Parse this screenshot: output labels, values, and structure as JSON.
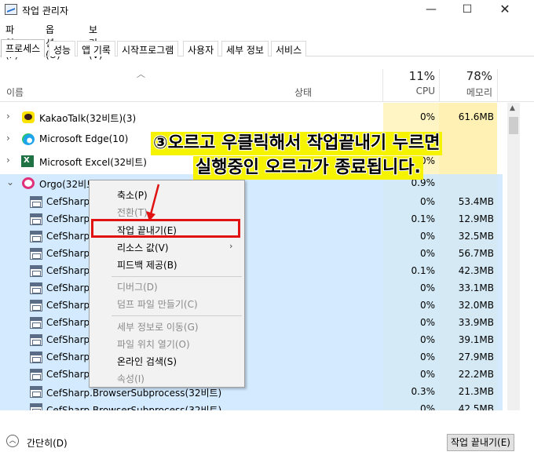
{
  "window": {
    "title": "작업 관리자",
    "minimize": "—",
    "maximize": "☐",
    "close": "✕"
  },
  "menu": [
    "파일(F)",
    "옵션(O)",
    "보기(V)"
  ],
  "tabs": [
    "프로세스",
    "성능",
    "앱 기록",
    "시작프로그램",
    "사용자",
    "세부 정보",
    "서비스"
  ],
  "columns": {
    "name": "이름",
    "status": "상태",
    "cpu_pct": "11%",
    "cpu_label": "CPU",
    "mem_pct": "78%",
    "mem_label": "메모리"
  },
  "processes": [
    {
      "name": "KakaoTalk(32비트)(3)",
      "cpu": "0%",
      "mem": "61.6MB",
      "icon": "kakaotalk-icon"
    },
    {
      "name": "Microsoft Edge(10)",
      "cpu": "0%",
      "mem": "",
      "icon": "edge-icon"
    },
    {
      "name": "Microsoft Excel(32비트)",
      "cpu": "0%",
      "mem": "",
      "icon": "excel-icon"
    },
    {
      "name": "Orgo(32비트)(27)",
      "cpu": "0.9%",
      "mem": "",
      "icon": "orgo-icon"
    }
  ],
  "subprocesses": [
    {
      "name": "CefSharp.B",
      "cpu": "0%",
      "mem": "53.4MB"
    },
    {
      "name": "CefSharp.B",
      "cpu": "0.1%",
      "mem": "12.9MB"
    },
    {
      "name": "CefSharp.B",
      "cpu": "0%",
      "mem": "32.5MB"
    },
    {
      "name": "CefSharp.B",
      "cpu": "0%",
      "mem": "56.7MB"
    },
    {
      "name": "CefSharp.B",
      "cpu": "0.1%",
      "mem": "42.3MB"
    },
    {
      "name": "CefSharp.B",
      "cpu": "0%",
      "mem": "33.1MB"
    },
    {
      "name": "CefSharp.B",
      "cpu": "0%",
      "mem": "32.0MB"
    },
    {
      "name": "CefSharp.B",
      "cpu": "0%",
      "mem": "33.9MB"
    },
    {
      "name": "CefSharp.B",
      "cpu": "0%",
      "mem": "39.1MB"
    },
    {
      "name": "CefSharp.B",
      "cpu": "0%",
      "mem": "27.9MB"
    },
    {
      "name": "CefSharp.B",
      "cpu": "0%",
      "mem": "22.2MB"
    },
    {
      "name": "CefSharp.BrowserSubprocess(32비트)",
      "cpu": "0.3%",
      "mem": "21.3MB"
    },
    {
      "name": "CefSharp.BrowserSubprocess(32비트)",
      "cpu": "0%",
      "mem": "42.5MB"
    }
  ],
  "context_menu": {
    "collapse": "축소(P)",
    "switch": "전환(T)",
    "end_task": "작업 끝내기(E)",
    "resource_values": "리소스 값(V)",
    "feedback": "피드백 제공(B)",
    "debug": "디버그(D)",
    "dump": "덤프 파일 만들기(C)",
    "goto_details": "세부 정보로 이동(G)",
    "open_location": "파일 위치 열기(O)",
    "search_online": "온라인 검색(S)",
    "properties": "속성(I)"
  },
  "annotation": {
    "line1": "③오르고 우클릭해서 작업끝내기 누르면",
    "line2": "실행중인 오르고가 종료됩니다."
  },
  "footer": {
    "collapse_label": "간단히(D)",
    "end_task_button": "작업 끝내기(E)"
  },
  "colors": {
    "highlight_box": "#e01212",
    "annotation_bg": "#f6f300",
    "selection": "#cce8ff",
    "cpu_col": "#fff4c4",
    "mem_col": "#fff0b3"
  }
}
